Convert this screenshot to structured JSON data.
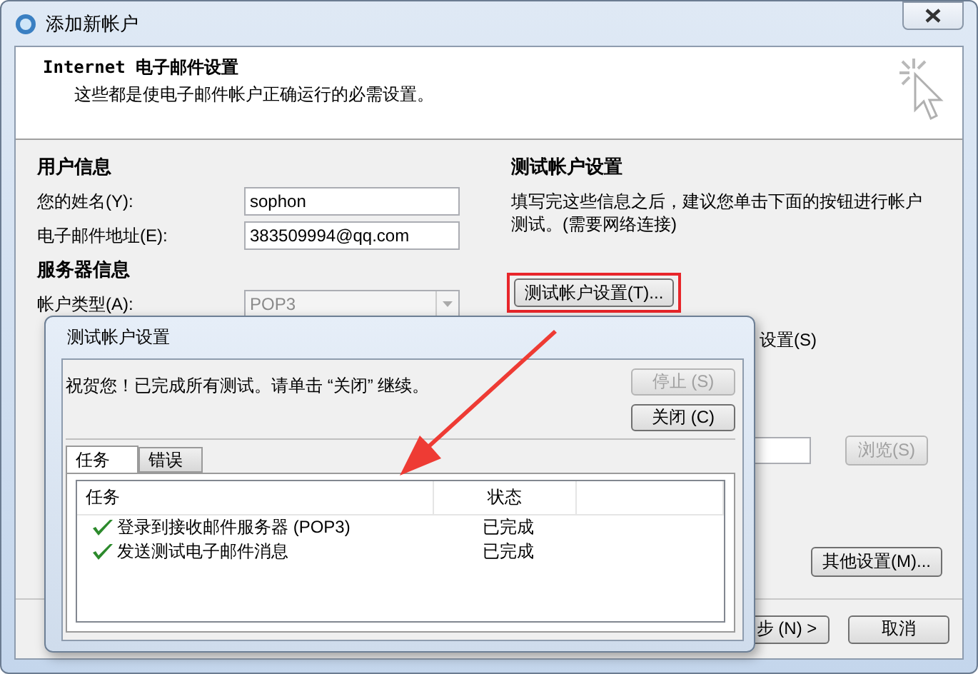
{
  "window": {
    "title": "添加新帐户"
  },
  "header": {
    "title": "Internet 电子邮件设置",
    "subtitle": "这些都是使电子邮件帐户正确运行的必需设置。"
  },
  "user_info": {
    "heading": "用户信息",
    "fields": [
      {
        "label": "您的姓名(Y):",
        "value": "sophon"
      },
      {
        "label": "电子邮件地址(E):",
        "value": "383509994@qq.com"
      }
    ]
  },
  "server_info": {
    "heading": "服务器信息",
    "fields": [
      {
        "label": "帐户类型(A):",
        "value": "POP3",
        "disabled": true
      }
    ]
  },
  "test_settings": {
    "heading": "测试帐户设置",
    "description": "填写完这些信息之后，建议您单击下面的按钮进行帐户测试。(需要网络连接)",
    "button": "测试帐户设置(T)...",
    "highlighted": true,
    "auto_test_label": "设置(S)",
    "browse_button": "浏览(S)",
    "more_settings_button": "其他设置(M)..."
  },
  "footer": {
    "buttons": [
      {
        "label": "步 (N) >"
      },
      {
        "label": "取消"
      }
    ]
  },
  "dialog": {
    "title": "测试帐户设置",
    "message": "祝贺您！已完成所有测试。请单击 “关闭” 继续。",
    "buttons": [
      {
        "label": "停止 (S)",
        "disabled": true
      },
      {
        "label": "关闭 (C)",
        "disabled": false
      }
    ],
    "tabs": [
      {
        "label": "任务",
        "selected": true
      },
      {
        "label": "错误",
        "selected": false
      }
    ],
    "columns": [
      "任务",
      "状态"
    ],
    "rows": [
      {
        "task": "登录到接收邮件服务器 (POP3)",
        "status": "已完成",
        "done": true
      },
      {
        "task": "发送测试电子邮件消息",
        "status": "已完成",
        "done": true
      }
    ]
  }
}
